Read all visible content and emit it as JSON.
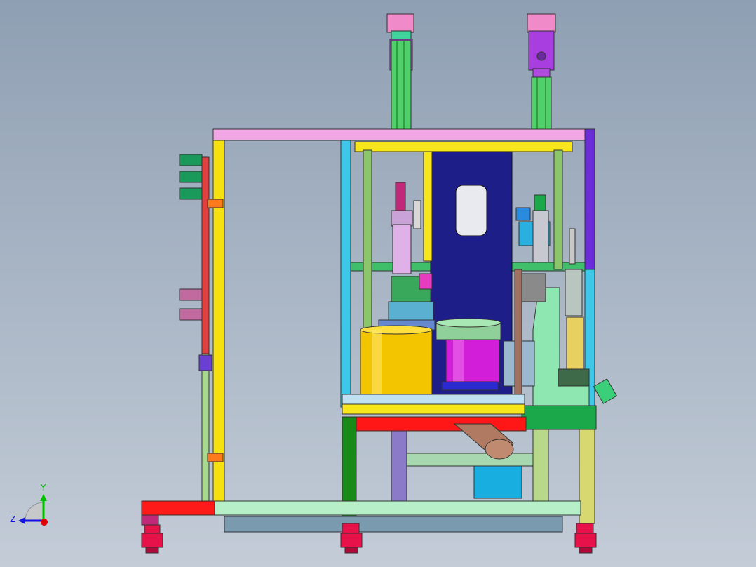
{
  "view": {
    "background_top": "#8f9fb3",
    "background_bottom": "#c3ccd7"
  },
  "triad": {
    "y_label": "Y",
    "z_label": "Z",
    "y_color": "#00c000",
    "z_color": "#1010e0",
    "origin_color": "#e00000"
  },
  "parts": [
    {
      "name": "left-upright-profile",
      "color": "#f5e10f"
    },
    {
      "name": "top-crossbar",
      "color": "#f2a6e6"
    },
    {
      "name": "right-upright-blue",
      "color": "#6a2dd8"
    },
    {
      "name": "inner-frame-cyan",
      "color": "#3ec7e8"
    },
    {
      "name": "table-top-yellow",
      "color": "#f7e61b"
    },
    {
      "name": "table-beam-red",
      "color": "#ff1616"
    },
    {
      "name": "table-leg-green",
      "color": "#178a17"
    },
    {
      "name": "base-beam-mint",
      "color": "#b7f0c8"
    },
    {
      "name": "base-end-red",
      "color": "#ff1a1a"
    },
    {
      "name": "leveling-foot",
      "color": "#e8124a"
    },
    {
      "name": "gear-motor-pink",
      "color": "#f08ac8"
    },
    {
      "name": "linear-rail-green",
      "color": "#4fd06a"
    },
    {
      "name": "back-plate-navy",
      "color": "#1e1e88"
    },
    {
      "name": "yellow-drum",
      "color": "#f3c400"
    },
    {
      "name": "magenta-rotary-table",
      "color": "#d21ed8"
    },
    {
      "name": "press-frame-mint",
      "color": "#8ee6b0"
    },
    {
      "name": "control-box-cyan",
      "color": "#19aee0"
    },
    {
      "name": "chute-brown",
      "color": "#b07a62"
    },
    {
      "name": "valve-manifold-rod",
      "color": "#e04040"
    }
  ]
}
